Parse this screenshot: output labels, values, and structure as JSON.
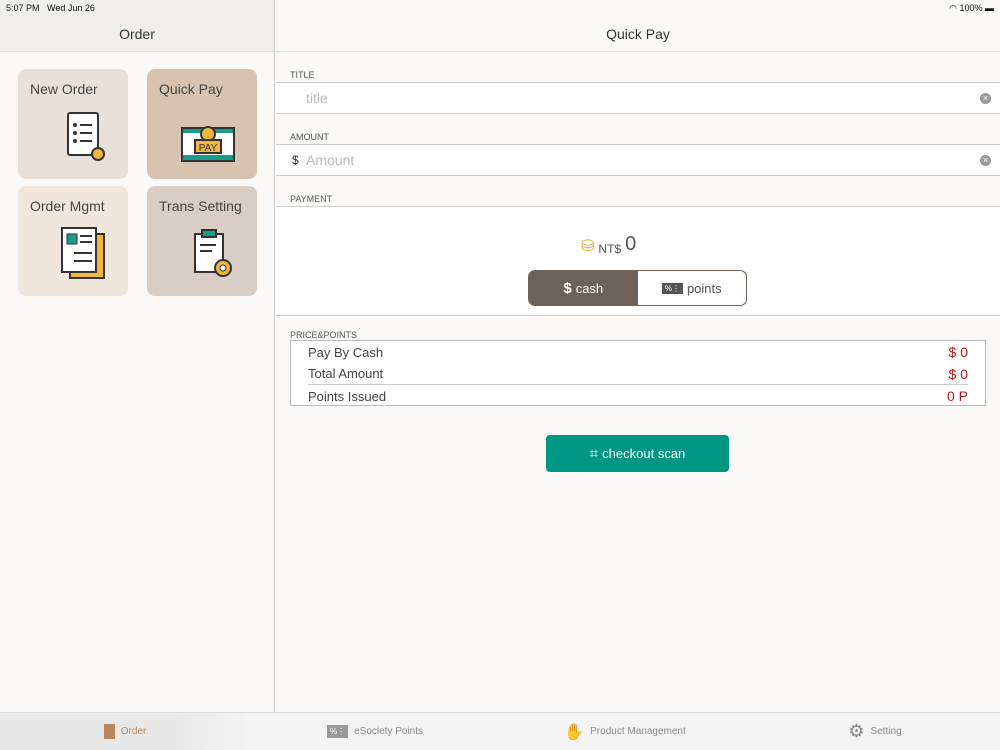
{
  "status": {
    "time": "5:07 PM",
    "date": "Wed Jun 26",
    "battery": "100%"
  },
  "left": {
    "title": "Order",
    "tiles": [
      {
        "label": "New Order",
        "color": "#e8e0da"
      },
      {
        "label": "Quick Pay",
        "color": "#d8c3b0"
      },
      {
        "label": "Order Mgmt",
        "color": "#f0e6dc"
      },
      {
        "label": "Trans Setting",
        "color": "#d8cec5"
      }
    ]
  },
  "main": {
    "title": "Quick Pay",
    "title_label": "TITLE",
    "title_placeholder": "title",
    "amount_label": "AMOUNT",
    "currency": "$",
    "amount_placeholder": "Amount",
    "payment_label": "PAYMENT",
    "nt": "NT$",
    "total": "0",
    "cash": "cash",
    "points": "points",
    "pp_label": "PRICE&POINTS",
    "rows": [
      {
        "label": "Pay By Cash",
        "value": "$ 0"
      },
      {
        "label": "Total Amount",
        "value": "$ 0"
      },
      {
        "label": "Points Issued",
        "value": "0 P"
      }
    ],
    "checkout": "checkout scan"
  },
  "tabs": [
    {
      "label": "Order"
    },
    {
      "label": "eSociety Points"
    },
    {
      "label": "Product Management"
    },
    {
      "label": "Setting"
    }
  ],
  "colors": {
    "accent": "#009684",
    "segment": "#6d625a",
    "value": "#b01c1c"
  }
}
